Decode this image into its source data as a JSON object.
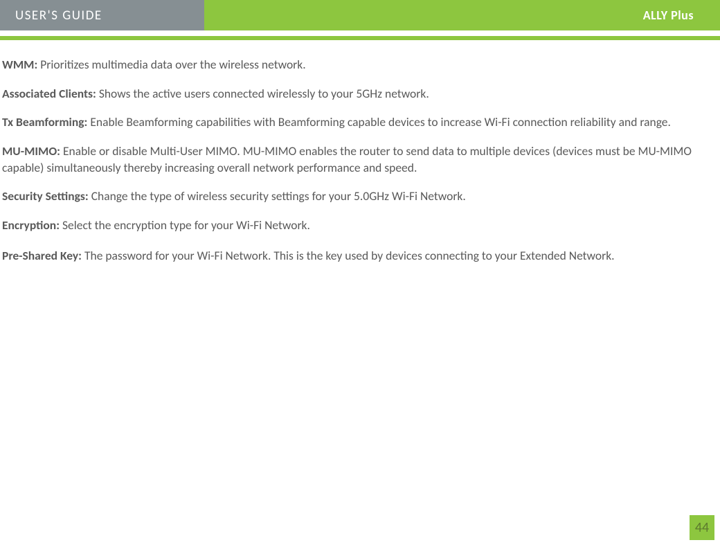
{
  "header": {
    "left_title": "USER'S GUIDE",
    "right_title": "ALLY Plus"
  },
  "definitions": [
    {
      "term": "WMM:",
      "text": " Prioritizes multimedia data over the wireless network."
    },
    {
      "term": "Associated Clients:",
      "text": " Shows the active users connected wirelessly to your 5GHz network."
    },
    {
      "term": "Tx Beamforming:",
      "text": " Enable Beamforming capabilities with Beamforming capable devices to increase Wi-Fi connection reliability and range."
    },
    {
      "term": "MU-MIMO:",
      "text": " Enable or disable Multi-User MIMO.  MU-MIMO enables the router to send data to multiple devices (devices must be MU-MIMO capable) simultaneously thereby increasing overall network performance and speed."
    },
    {
      "term": "Security Settings:",
      "text": " Change the type of wireless security settings for your 5.0GHz Wi-Fi Network."
    },
    {
      "term": "Encryption:",
      "text": " Select the encryption type for your Wi-Fi Network."
    },
    {
      "term": "Pre-Shared Key:",
      "text": " The password for your Wi-Fi Network. This is the key used by devices connecting to your Extended Network."
    }
  ],
  "page_number": "44"
}
